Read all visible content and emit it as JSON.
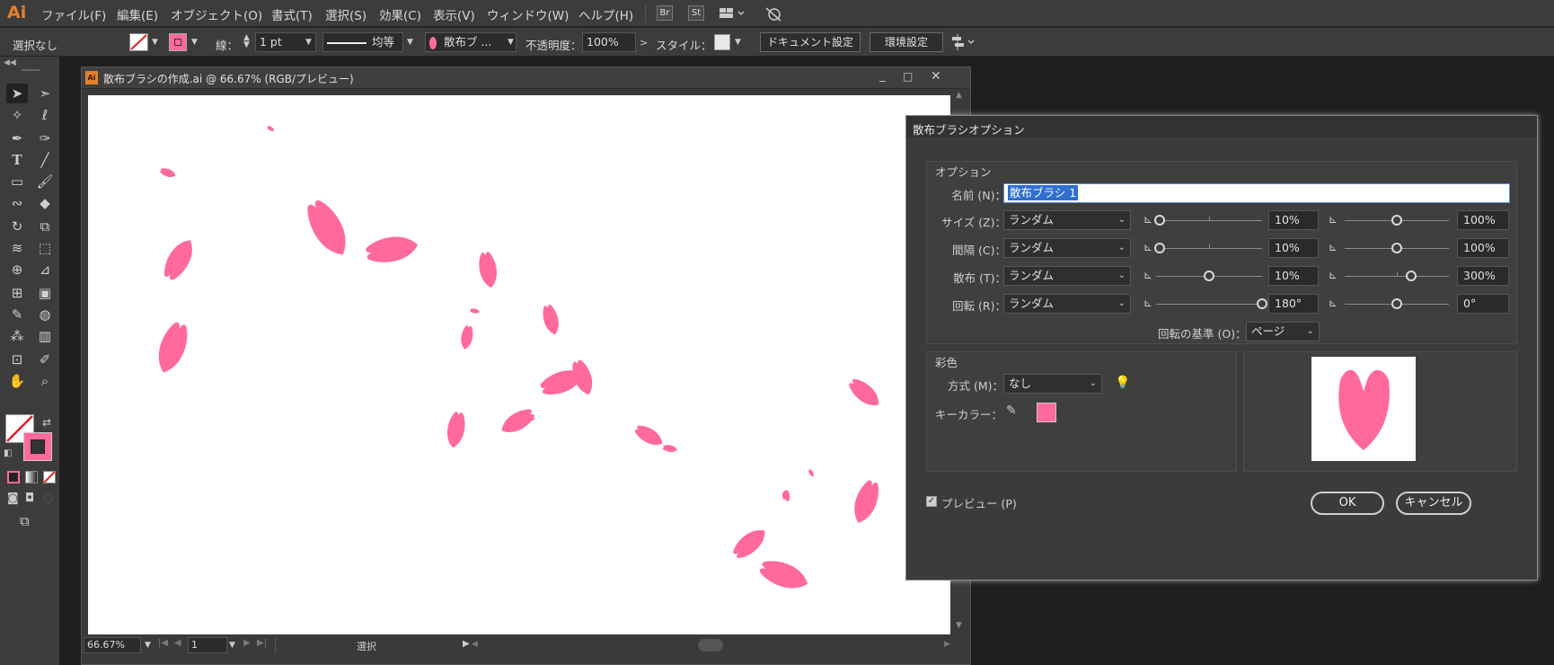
{
  "app": {
    "logo": "Ai"
  },
  "menu": [
    "ファイル(F)",
    "編集(E)",
    "オブジェクト(O)",
    "書式(T)",
    "選択(S)",
    "効果(C)",
    "表示(V)",
    "ウィンドウ(W)",
    "ヘルプ(H)"
  ],
  "menu_icons": {
    "br": "Br",
    "st": "St"
  },
  "control_bar": {
    "selection": "選択なし",
    "stroke_label": "線：",
    "stroke_weight": "1 pt",
    "profile": "均等",
    "brush": "散布ブ ...",
    "opacity_label": "不透明度：",
    "opacity": "100%",
    "style_label": "スタイル：",
    "doc_setup": "ドキュメント設定",
    "prefs": "環境設定"
  },
  "document": {
    "title": "散布ブラシの作成.ai @ 66.67% (RGB/プレビュー)",
    "zoom": "66.67%",
    "page": "1",
    "status": "選択",
    "petal_color": "#ff6a9a"
  },
  "dialog": {
    "title": "散布ブラシオプション",
    "options_group": "オプション",
    "name_label": "名前 (N)：",
    "name_value": "散布ブラシ 1",
    "rows": [
      {
        "label": "サイズ (Z)：",
        "mode": "ランダム",
        "min": "10%",
        "max": "100%"
      },
      {
        "label": "間隔 (C)：",
        "mode": "ランダム",
        "min": "10%",
        "max": "100%"
      },
      {
        "label": "散布 (T)：",
        "mode": "ランダム",
        "min": "10%",
        "max": "300%"
      },
      {
        "label": "回転 (R)：",
        "mode": "ランダム",
        "min": "180°",
        "max": "0°"
      }
    ],
    "rotation_base_label": "回転の基準 (O)：",
    "rotation_base_value": "ページ",
    "color_group": "彩色",
    "method_label": "方式 (M)：",
    "method_value": "なし",
    "keycolor_label": "キーカラー：",
    "key_color": "#ff6a9a",
    "preview_label": "プレビュー (P)",
    "ok": "OK",
    "cancel": "キャンセル"
  }
}
